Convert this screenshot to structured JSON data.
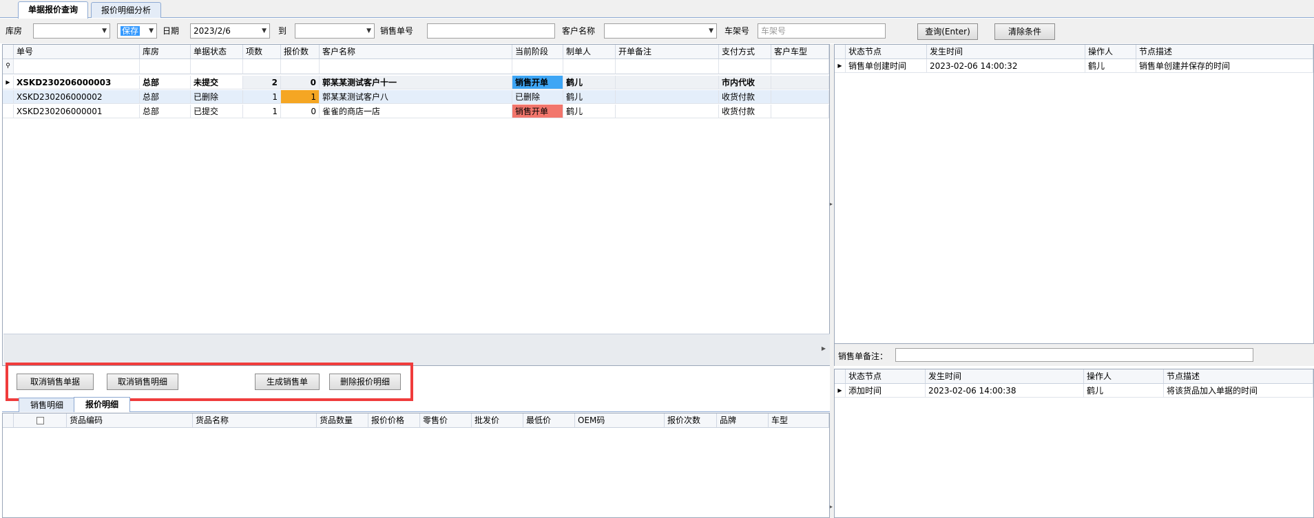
{
  "tabs": {
    "quote_query": "单据报价查询",
    "quote_detail": "报价明细分析"
  },
  "filters": {
    "warehouse_label": "库房",
    "warehouse_value": "",
    "status_value": "保存",
    "date_label": "日期",
    "date_from": "2023/2/6",
    "to_label": "到",
    "date_to": "",
    "order_no_label": "销售单号",
    "order_no_value": "",
    "customer_label": "客户名称",
    "customer_value": "",
    "frame_label": "车架号",
    "frame_placeholder": "车架号",
    "query_button": "查询(Enter)",
    "clear_button": "清除条件"
  },
  "main_grid": {
    "headers": [
      "单号",
      "库房",
      "单据状态",
      "项数",
      "报价数",
      "客户名称",
      "当前阶段",
      "制单人",
      "开单备注",
      "支付方式",
      "客户车型"
    ],
    "rows": [
      {
        "no": "XSKD230206000003",
        "warehouse": "总部",
        "status": "未提交",
        "items": "2",
        "quotes": "0",
        "customer": "郭某某测试客户十一",
        "stage": "销售开单",
        "creator": "鹤儿",
        "remark": "",
        "payment": "市内代收",
        "car": ""
      },
      {
        "no": "XSKD230206000002",
        "warehouse": "总部",
        "status": "已删除",
        "items": "1",
        "quotes": "1",
        "customer": "郭某某测试客户八",
        "stage": "已删除",
        "creator": "鹤儿",
        "remark": "",
        "payment": "收货付款",
        "car": ""
      },
      {
        "no": "XSKD230206000001",
        "warehouse": "总部",
        "status": "已提交",
        "items": "1",
        "quotes": "0",
        "customer": "雀雀的商店一店",
        "stage": "销售开单",
        "creator": "鹤儿",
        "remark": "",
        "payment": "收货付款",
        "car": ""
      }
    ]
  },
  "status_grid": {
    "headers": [
      "状态节点",
      "发生时间",
      "操作人",
      "节点描述"
    ],
    "row": {
      "node": "销售单创建时间",
      "time": "2023-02-06 14:00:32",
      "operator": "鹤儿",
      "desc": "销售单创建并保存的时间"
    }
  },
  "note": {
    "label": "销售单备注：",
    "value": ""
  },
  "item_status_grid": {
    "headers": [
      "状态节点",
      "发生时间",
      "操作人",
      "节点描述"
    ],
    "row": {
      "node": "添加时间",
      "time": "2023-02-06 14:00:38",
      "operator": "鹤儿",
      "desc": "将该货品加入单据的时间"
    }
  },
  "actions": {
    "cancel_order": "取消销售单据",
    "cancel_detail": "取消销售明细",
    "generate_order": "生成销售单",
    "delete_quote": "删除报价明细"
  },
  "bottom_tabs": {
    "sales_detail": "销售明细",
    "quote_detail": "报价明细"
  },
  "bottom_grid": {
    "headers": [
      "货品编码",
      "货品名称",
      "货品数量",
      "报价价格",
      "零售价",
      "批发价",
      "最低价",
      "OEM码",
      "报价次数",
      "品牌",
      "车型"
    ]
  },
  "colors": {
    "stage_blue": "#3ea6f5",
    "stage_red": "#f2766c",
    "quote_orange": "#f5a623",
    "highlight_red": "#f03c3c"
  }
}
